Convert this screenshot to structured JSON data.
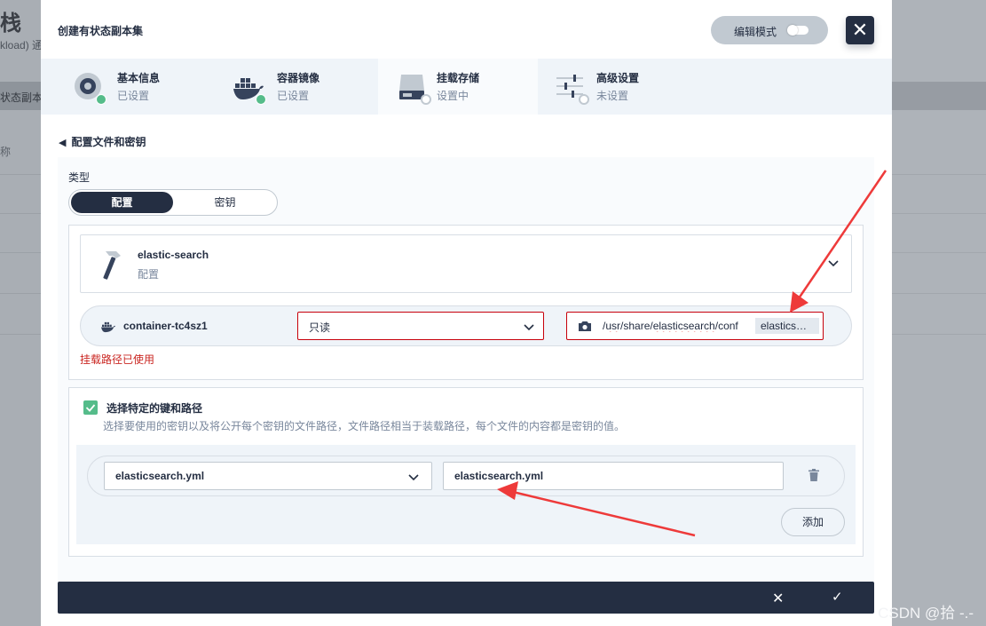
{
  "background": {
    "title_fragment": "栈",
    "subtitle_fragment": "kload) 通",
    "bar_fragment": "状态副本集",
    "row_fragment": "称"
  },
  "watermark": "CSDN @拾 -.-",
  "modal": {
    "title": "创建有状态副本集",
    "edit_mode_label": "编辑模式",
    "close_glyph": "✕",
    "steps": [
      {
        "name": "基本信息",
        "status": "已设置",
        "icon": "disk-icon"
      },
      {
        "name": "容器镜像",
        "status": "已设置",
        "icon": "docker-icon"
      },
      {
        "name": "挂载存储",
        "status": "设置中",
        "icon": "storage-icon"
      },
      {
        "name": "高级设置",
        "status": "未设置",
        "icon": "sliders-icon"
      }
    ],
    "back_label": "配置文件和密钥",
    "type_label": "类型",
    "type_options": [
      "配置",
      "密钥"
    ],
    "selected_type": "配置",
    "resource": {
      "name": "elastic-search",
      "kind": "配置"
    },
    "mount": {
      "container": "container-tc4sz1",
      "mode": "只读",
      "path_prefix": "/",
      "path_usr": "usr",
      "path_mid": "/share/",
      "path_es": "elasticsearch",
      "path_tail": "/conf",
      "autocomplete": "elastics…"
    },
    "error": "挂载路径已使用",
    "specific_keys": {
      "checked": true,
      "title": "选择特定的键和路径",
      "desc": "选择要使用的密钥以及将公开每个密钥的文件路径，文件路径相当于装载路径，每个文件的内容都是密钥的值。",
      "key_value": "elasticsearch.yml",
      "path_value": "elasticsearch.yml",
      "add_label": "添加"
    },
    "footer": {
      "cancel_glyph": "✕",
      "confirm_glyph": "✓"
    }
  },
  "colors": {
    "primary": "#242e42",
    "success": "#55bc8a",
    "error": "#ca2621",
    "annotation": "#ee3a3a"
  }
}
